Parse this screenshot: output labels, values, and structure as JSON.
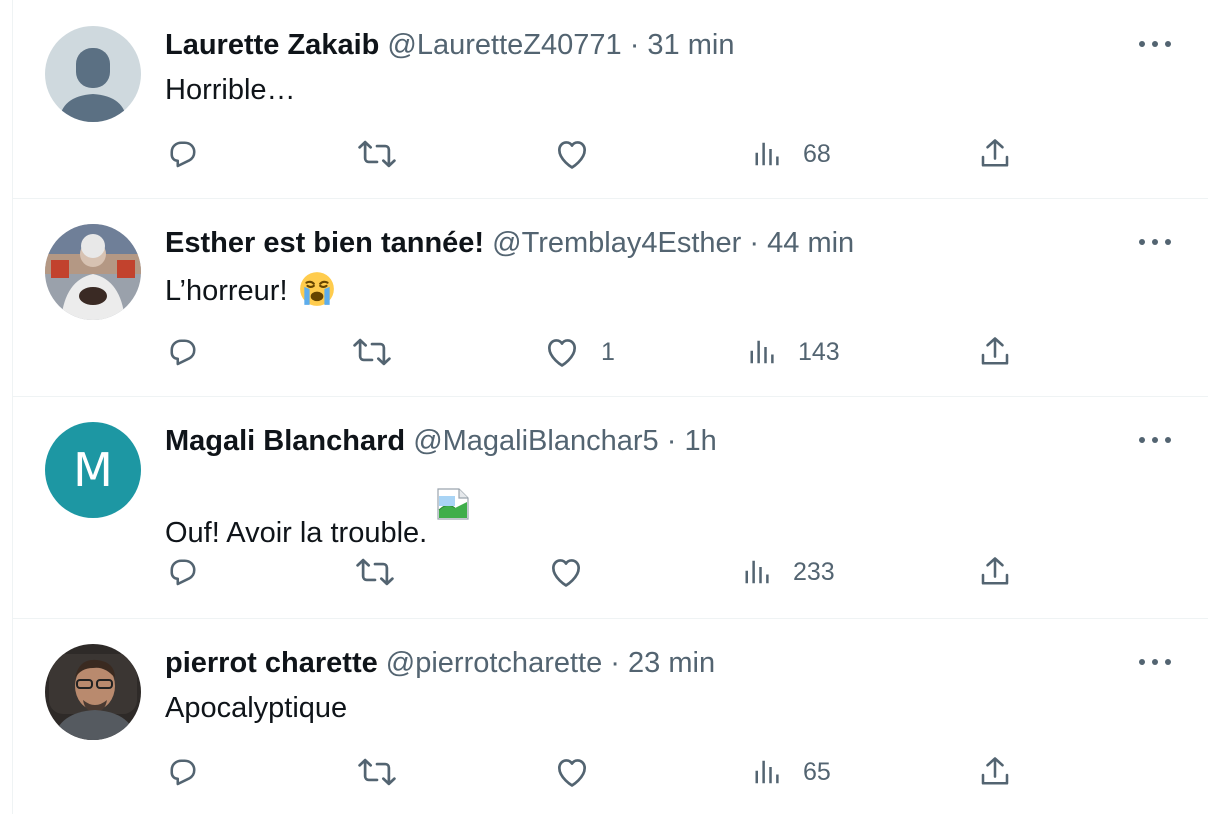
{
  "tweets": [
    {
      "name": "Laurette Zakaib",
      "handle": "@LauretteZ40771",
      "separator": "·",
      "time": "31 min",
      "text": "Horrible…",
      "avatar": "default-avatar",
      "replies": "",
      "retweets": "",
      "likes": "",
      "views": "68"
    },
    {
      "name": "Esther est bien tannée!",
      "handle": "@Tremblay4Esther",
      "separator": "·",
      "time": "44 min",
      "text": "L’horreur!",
      "emoji": "crying-face-emoji",
      "avatar": "photo-avatar",
      "replies": "",
      "retweets": "",
      "likes": "1",
      "views": "143"
    },
    {
      "name": "Magali Blanchard",
      "handle": "@MagaliBlanchar5",
      "separator": "·",
      "time": "1h",
      "text": "Ouf! Avoir la trouble.",
      "avatar_letter": "M",
      "avatar_color": "#1d97a3",
      "replies": "",
      "retweets": "",
      "likes": "",
      "views": "233"
    },
    {
      "name": "pierrot charette",
      "handle": "@pierrotcharette",
      "separator": "·",
      "time": "23 min",
      "text": "Apocalyptique",
      "avatar": "photo-avatar",
      "replies": "",
      "retweets": "",
      "likes": "",
      "views": "65"
    }
  ],
  "icons": {
    "reply": "reply-icon",
    "retweet": "retweet-icon",
    "like": "like-icon",
    "views": "views-icon",
    "share": "share-icon",
    "more": "more-icon"
  },
  "colors": {
    "text_primary": "#0f1419",
    "text_secondary": "#536471",
    "border": "#eff3f4"
  }
}
